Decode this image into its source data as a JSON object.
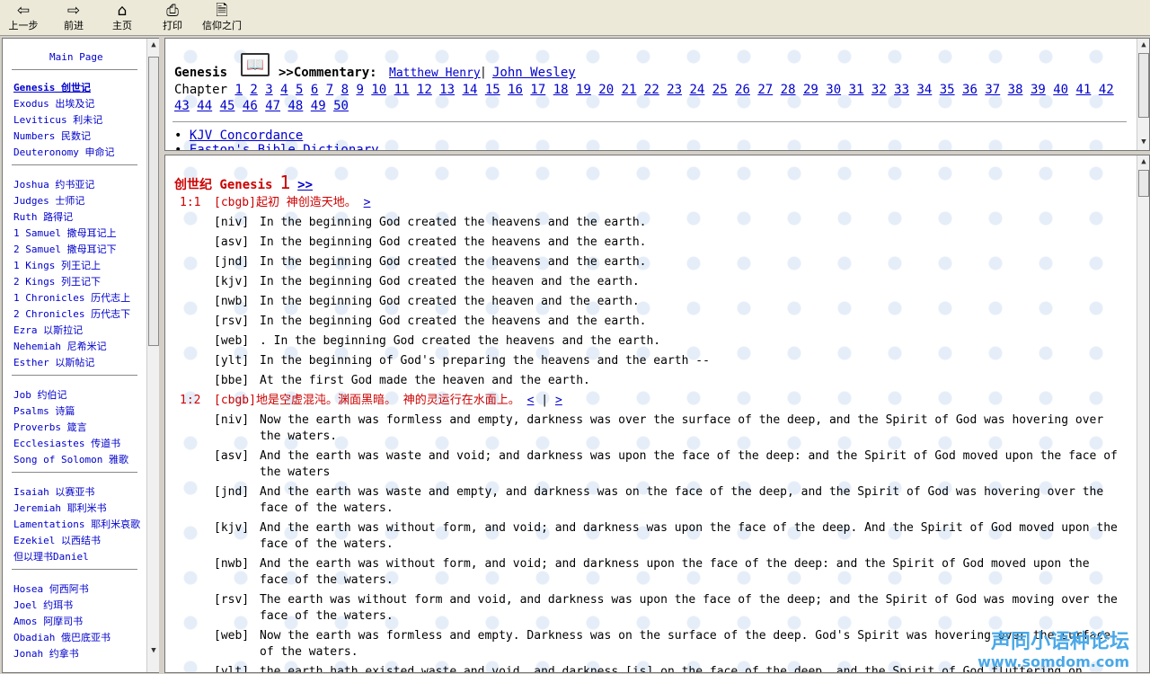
{
  "toolbar": {
    "back": "上一步",
    "forward": "前进",
    "home": "主页",
    "print": "打印",
    "faith": "信仰之门"
  },
  "sidebar": {
    "main_page": "Main Page",
    "groups": [
      [
        "Genesis 创世记",
        "Exodus 出埃及记",
        "Leviticus 利未记",
        "Numbers 民数记",
        "Deuteronomy 申命记"
      ],
      [
        "Joshua 约书亚记",
        "Judges 士师记",
        "Ruth 路得记",
        "1 Samuel 撒母耳记上",
        "2 Samuel 撒母耳记下",
        "1 Kings 列王记上",
        "2 Kings 列王记下",
        "1 Chronicles 历代志上",
        "2 Chronicles 历代志下",
        "Ezra 以斯拉记",
        "Nehemiah 尼希米记",
        "Esther 以斯帖记"
      ],
      [
        "Job 约伯记",
        "Psalms 诗篇",
        "Proverbs 箴言",
        "Ecclesiastes 传道书",
        "Song of Solomon 雅歌"
      ],
      [
        "Isaiah 以赛亚书",
        "Jeremiah 耶利米书",
        "Lamentations 耶利米哀歌",
        "Ezekiel 以西结书",
        "但以理书Daniel"
      ],
      [
        "Hosea 何西阿书",
        "Joel 约珥书",
        "Amos 阿摩司书",
        "Obadiah 俄巴底亚书",
        "Jonah 约拿书"
      ]
    ]
  },
  "top": {
    "book": "Genesis",
    "commentary_prefix": ">>Commentary:",
    "commentary_links": [
      "Matthew Henry",
      "John Wesley"
    ],
    "separator": "|",
    "chapter_label": "Chapter",
    "chapters": [
      "1",
      "2",
      "3",
      "4",
      "5",
      "6",
      "7",
      "8",
      "9",
      "10",
      "11",
      "12",
      "13",
      "14",
      "15",
      "16",
      "17",
      "18",
      "19",
      "20",
      "21",
      "22",
      "23",
      "24",
      "25",
      "26",
      "27",
      "28",
      "29",
      "30",
      "31",
      "32",
      "33",
      "34",
      "35",
      "36",
      "37",
      "38",
      "39",
      "40",
      "41",
      "42",
      "43",
      "44",
      "45",
      "46",
      "47",
      "48",
      "49",
      "50"
    ],
    "resources": [
      "KJV Concordance",
      "Easton's Bible Dictionary"
    ]
  },
  "main": {
    "heading_cn": "创世纪 Genesis",
    "heading_num": "1",
    "heading_next": ">>",
    "verses": [
      {
        "ref": "1:1",
        "cbgb": "[cbgb]起初  神创造天地。",
        "nav": ">",
        "versions": [
          {
            "tag": "[niv]",
            "text": "In the beginning God created the heavens and the earth."
          },
          {
            "tag": "[asv]",
            "text": "In the beginning God created the heavens and the earth."
          },
          {
            "tag": "[jnd]",
            "text": "In the beginning God created the heavens and the earth."
          },
          {
            "tag": "[kjv]",
            "text": "In the beginning God created the heaven and the earth."
          },
          {
            "tag": "[nwb]",
            "text": "In the beginning God created the heaven and the earth."
          },
          {
            "tag": "[rsv]",
            "text": "In the beginning God created the heavens and the earth."
          },
          {
            "tag": "[web]",
            "text": ". In the beginning God created the heavens and the earth."
          },
          {
            "tag": "[ylt]",
            "text": "In the beginning of God's preparing the heavens and the earth --"
          },
          {
            "tag": "[bbe]",
            "text": "At the first God made the heaven and the earth."
          }
        ]
      },
      {
        "ref": "1:2",
        "cbgb": "[cbgb]地是空虚混沌。渊面黑暗。  神的灵运行在水面上。",
        "nav_prev": "<",
        "nav_sep": "|",
        "nav": ">",
        "versions": [
          {
            "tag": "[niv]",
            "text": "Now the earth was formless and empty, darkness was over the surface of the deep, and the Spirit of God was hovering over the waters."
          },
          {
            "tag": "[asv]",
            "text": "And the earth was waste and void; and darkness was upon the face of the deep: and the Spirit of God moved upon the face of the waters"
          },
          {
            "tag": "[jnd]",
            "text": "And the earth was waste and empty, and darkness was on the face of the deep, and the Spirit of God was hovering over the face of the waters."
          },
          {
            "tag": "[kjv]",
            "text": "And the earth was without form, and void; and darkness was upon the face of the deep. And the Spirit of God moved upon the face of the waters."
          },
          {
            "tag": "[nwb]",
            "text": "And the earth was without form, and void; and darkness upon the face of the deep: and the Spirit of God moved upon the face of the waters."
          },
          {
            "tag": "[rsv]",
            "text": "The earth was without form and void, and darkness was upon the face of the deep; and the Spirit of God was moving over the face of the waters."
          },
          {
            "tag": "[web]",
            "text": "Now the earth was formless and empty. Darkness was on the surface of the deep. God's Spirit was hovering over the surface of the waters."
          },
          {
            "tag": "[ylt]",
            "text": "the earth hath existed waste and void, and darkness [is] on the face of the deep, and the Spirit of God fluttering on"
          }
        ]
      }
    ]
  },
  "watermark": {
    "line1": "声同小语种论坛",
    "line2": "www.somdom.com"
  }
}
